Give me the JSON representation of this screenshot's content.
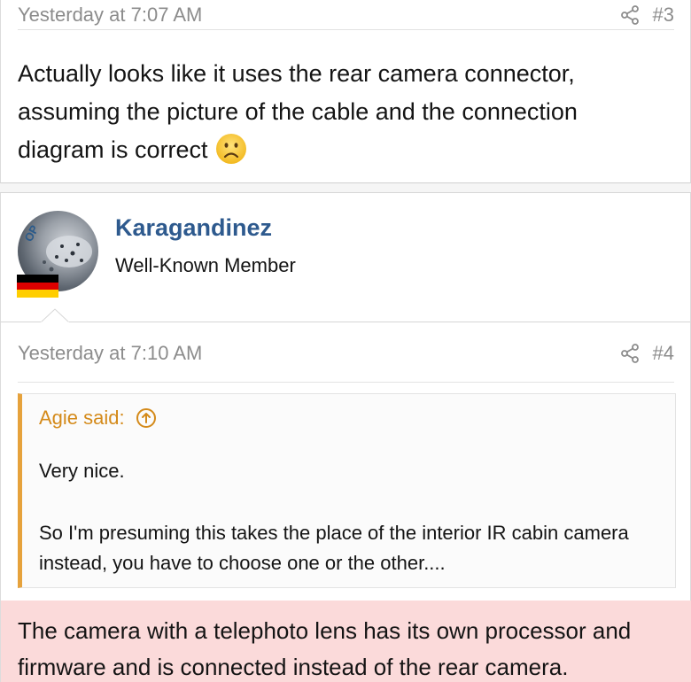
{
  "post3": {
    "timestamp": "Yesterday at 7:07 AM",
    "post_number": "#3",
    "body": "Actually looks like it uses the rear camera connector, assuming the picture of the cable and the connection diagram is correct",
    "emoji": "frown-emoji"
  },
  "user": {
    "badge": "OP",
    "name": "Karagandinez",
    "title": "Well-Known Member",
    "flag_colors": [
      "#000000",
      "#dd0000",
      "#ffce00"
    ]
  },
  "post4": {
    "timestamp": "Yesterday at 7:10 AM",
    "post_number": "#4",
    "quote": {
      "author_label": "Agie said:",
      "line1": "Very nice.",
      "line2": "So I'm presuming this takes the place of the interior IR cabin camera instead, you have to choose one or the other...."
    },
    "body": "The camera with a telephoto lens has its own processor and firmware and is connected instead of the rear camera."
  },
  "colors": {
    "username": "#2e5a8e",
    "quote_accent": "#e6a23c",
    "quote_author": "#d48a1a",
    "highlight": "#fbdada",
    "meta_text": "#8c8c8c"
  },
  "icons": [
    "share-icon",
    "arrow-up-icon",
    "frown-emoji"
  ]
}
